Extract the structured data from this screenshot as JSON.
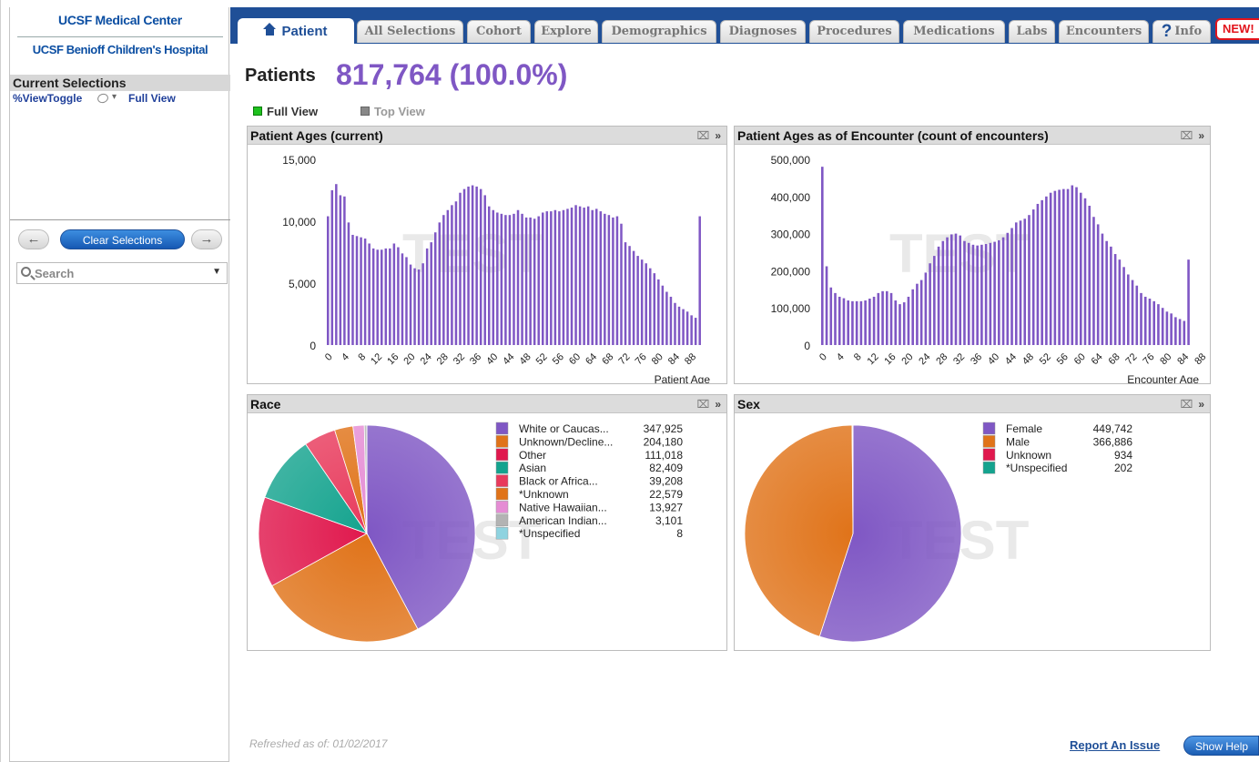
{
  "logo": {
    "line1": "UCSF Medical Center",
    "line2": "UCSF Benioff Children's Hospital"
  },
  "selections": {
    "header": "Current Selections",
    "view_toggle": "%ViewToggle",
    "full_view": "Full View"
  },
  "buttons": {
    "back": "←",
    "clear": "Clear Selections",
    "forward": "→"
  },
  "search": {
    "placeholder": "Search"
  },
  "tabs": [
    {
      "label": "Patient",
      "active": true
    },
    {
      "label": "All Selections"
    },
    {
      "label": "Cohort"
    },
    {
      "label": "Explore"
    },
    {
      "label": "Demographics"
    },
    {
      "label": "Diagnoses"
    },
    {
      "label": "Procedures"
    },
    {
      "label": "Medications"
    },
    {
      "label": "Labs"
    },
    {
      "label": "Encounters"
    },
    {
      "label": "Info"
    }
  ],
  "new_badge": "NEW!",
  "summary": {
    "label": "Patients",
    "count": "817,764 (100.0%)"
  },
  "view_toggle": {
    "full": "Full View",
    "top": "Top View"
  },
  "watermark": "TEST",
  "footer": {
    "refreshed": "Refreshed as of:  01/02/2017",
    "report": "Report  An Issue",
    "help": "Show Help"
  },
  "colors": {
    "bar": "#7f57c4",
    "tabbar": "#1f4f97"
  },
  "chart_data": [
    {
      "type": "bar",
      "title": "Patient Ages (current)",
      "xlabel": "Patient Age",
      "ylim": [
        0,
        15000
      ],
      "yticks": [
        0,
        5000,
        10000,
        15000
      ],
      "ytick_labels": [
        "0",
        "5,000",
        "10,000",
        "15,000"
      ],
      "xtick_labels": [
        "0",
        "4",
        "8",
        "12",
        "16",
        "20",
        "24",
        "28",
        "32",
        "36",
        "40",
        "44",
        "48",
        "52",
        "56",
        "60",
        "64",
        "68",
        "72",
        "76",
        "80",
        "84",
        "88"
      ],
      "x_start": 0,
      "values": [
        10400,
        12500,
        13000,
        12100,
        12000,
        9900,
        8900,
        8800,
        8700,
        8600,
        8200,
        7800,
        7700,
        7700,
        7800,
        7800,
        8200,
        7900,
        7400,
        7100,
        6500,
        6200,
        6100,
        6600,
        7800,
        8300,
        9100,
        9900,
        10500,
        10900,
        11300,
        11600,
        12300,
        12600,
        12800,
        12900,
        12800,
        12600,
        12100,
        11200,
        10900,
        10700,
        10600,
        10500,
        10500,
        10600,
        10900,
        10600,
        10300,
        10300,
        10200,
        10400,
        10700,
        10800,
        10800,
        10900,
        10800,
        10900,
        11000,
        11100,
        11300,
        11200,
        11100,
        11200,
        10900,
        11000,
        10800,
        10600,
        10500,
        10300,
        10400,
        9800,
        8300,
        8000,
        7600,
        7200,
        6900,
        6600,
        6200,
        5800,
        5300,
        4800,
        4300,
        3900,
        3400,
        3100,
        2900,
        2700,
        2400,
        2200,
        10400
      ]
    },
    {
      "type": "bar",
      "title": "Patient Ages as of Encounter (count of encounters)",
      "xlabel": "Encounter Age",
      "ylim": [
        0,
        500000
      ],
      "yticks": [
        0,
        100000,
        200000,
        300000,
        400000,
        500000
      ],
      "ytick_labels": [
        "0",
        "100,000",
        "200,000",
        "300,000",
        "400,000",
        "500,000"
      ],
      "xtick_labels": [
        "0",
        "4",
        "8",
        "12",
        "16",
        "20",
        "24",
        "28",
        "32",
        "36",
        "40",
        "44",
        "48",
        "52",
        "56",
        "60",
        "64",
        "68",
        "72",
        "76",
        "80",
        "84",
        "88"
      ],
      "x_start": 0,
      "values": [
        480000,
        212000,
        155000,
        140000,
        130000,
        126000,
        120000,
        118000,
        118000,
        118000,
        120000,
        125000,
        130000,
        140000,
        145000,
        145000,
        140000,
        120000,
        110000,
        115000,
        130000,
        150000,
        165000,
        175000,
        195000,
        220000,
        240000,
        265000,
        280000,
        290000,
        298000,
        300000,
        295000,
        280000,
        275000,
        270000,
        268000,
        270000,
        272000,
        275000,
        278000,
        282000,
        290000,
        302000,
        315000,
        330000,
        335000,
        340000,
        350000,
        365000,
        380000,
        390000,
        400000,
        410000,
        415000,
        418000,
        420000,
        420000,
        430000,
        425000,
        410000,
        395000,
        375000,
        345000,
        325000,
        300000,
        280000,
        265000,
        245000,
        230000,
        210000,
        190000,
        175000,
        160000,
        140000,
        130000,
        125000,
        118000,
        110000,
        100000,
        90000,
        85000,
        75000,
        70000,
        65000,
        230000
      ]
    },
    {
      "type": "pie",
      "title": "Race",
      "slices": [
        {
          "label": "White or Caucas...",
          "value": 347925,
          "display": "347,925",
          "color": "#7f57c4"
        },
        {
          "label": "Unknown/Decline...",
          "value": 204180,
          "display": "204,180",
          "color": "#e07319"
        },
        {
          "label": "Other",
          "value": 111018,
          "display": "111,018",
          "color": "#e0184d"
        },
        {
          "label": "Asian",
          "value": 82409,
          "display": "82,409",
          "color": "#14a38e"
        },
        {
          "label": "Black or Africa...",
          "value": 39208,
          "display": "39,208",
          "color": "#e83a5c"
        },
        {
          "label": "*Unknown",
          "value": 22579,
          "display": "22,579",
          "color": "#e07319"
        },
        {
          "label": "Native Hawaiian...",
          "value": 13927,
          "display": "13,927",
          "color": "#e58cd4"
        },
        {
          "label": "American Indian...",
          "value": 3101,
          "display": "3,101",
          "color": "#b3b3b3"
        },
        {
          "label": "*Unspecified",
          "value": 8,
          "display": "8",
          "color": "#8fd3e0"
        }
      ]
    },
    {
      "type": "pie",
      "title": "Sex",
      "slices": [
        {
          "label": "Female",
          "value": 449742,
          "display": "449,742",
          "color": "#7f57c4"
        },
        {
          "label": "Male",
          "value": 366886,
          "display": "366,886",
          "color": "#e07319"
        },
        {
          "label": "Unknown",
          "value": 934,
          "display": "934",
          "color": "#e0184d"
        },
        {
          "label": "*Unspecified",
          "value": 202,
          "display": "202",
          "color": "#14a38e"
        }
      ]
    }
  ]
}
